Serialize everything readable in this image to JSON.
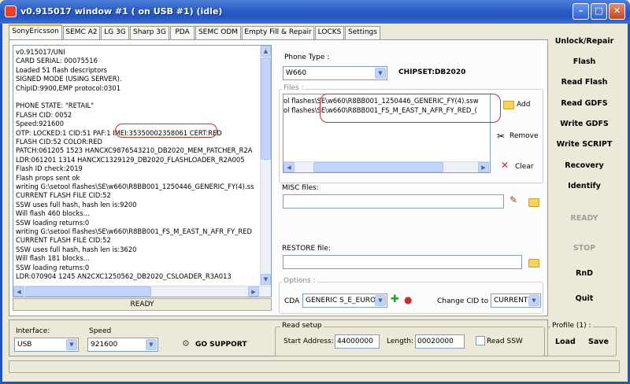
{
  "window": {
    "title": "v0.915017 window #1 ( on USB #1) (idle)",
    "minimize": "–",
    "maximize": "□",
    "close": "✕"
  },
  "tabs": [
    {
      "label": "SonyEricsson",
      "active": true
    },
    {
      "label": "SEMC A2"
    },
    {
      "label": "LG 3G"
    },
    {
      "label": "Sharp 3G"
    },
    {
      "label": "PDA"
    },
    {
      "label": "SEMC ODM"
    },
    {
      "label": "Empty Fill & Repair"
    },
    {
      "label": "LOCKS"
    },
    {
      "label": "Settings"
    }
  ],
  "log": {
    "lines": [
      "v0.915017/UNI",
      "CARD SERIAL: 00075516",
      "Loaded 51 flash descriptors",
      "SIGNED MODE (USING SERVER).",
      "ChipID:9900,EMP protocol:0301",
      "",
      "PHONE STATE: \"RETAIL\"",
      "FLASH CID: 0052",
      "Speed:921600",
      "OTP: LOCKED:1 CID:51 PAF:1 IMEI:35350002358061 CERT:RED",
      "FLASH CID:52 COLOR:RED",
      "PATCH:061205 1523 HANCXC9876543210_DB2020_MEM_PATCHER_R2A",
      "LDR:061201 1314 HANCXC1329129_DB2020_FLASHLOADER_R2A005",
      "Flash ID check:2019",
      "Flash props sent ok",
      "writing G:\\setool flashes\\SE\\w660\\R8BB001_1250446_GENERIC_FY(4).ss",
      "CURRENT FLASH FILE CID:52",
      "SSW uses full hash, hash len is:9200",
      "Will flash 460 blocks...",
      "SSW loading returns:0",
      "writing G:\\setool flashes\\SE\\w660\\R8BB001_FS_M_EAST_N_AFR_FY_RED",
      "CURRENT FLASH FILE CID:52",
      "SSW uses full hash, hash len is:3620",
      "Will flash 181 blocks...",
      "SSW loading returns:0",
      "LDR:070904 1245 AN2CXC1250562_DB2020_CSLOADER_R3A013"
    ],
    "status": "READY"
  },
  "phone": {
    "label": "Phone Type :",
    "value": "W660",
    "chipset": "CHIPSET:DB2020"
  },
  "files": {
    "label": "Files :",
    "rows": [
      "ol flashes\\SE\\w660\\R8BB001_1250446_GENERIC_FY(4).ssw",
      "ol flashes\\SE\\w660\\R8BB001_FS_M_EAST_N_AFR_FY_RED_("
    ],
    "add": "Add",
    "remove": "Remove",
    "clear": "Clear"
  },
  "misc": {
    "label": "MISC files:",
    "value": ""
  },
  "restore": {
    "label": "RESTORE file:",
    "value": ""
  },
  "options": {
    "label": "Options :",
    "cda_label": "CDA",
    "cda_value": "GENERIC S_E_EURO",
    "change_cid_label": "Change CID to",
    "change_cid_value": "CURRENT"
  },
  "right_buttons": [
    {
      "label": "Unlock/Repair",
      "enabled": true
    },
    {
      "label": "Flash",
      "enabled": true
    },
    {
      "label": "Read Flash",
      "enabled": true
    },
    {
      "label": "Read GDFS",
      "enabled": true
    },
    {
      "label": "Write GDFS",
      "enabled": true
    },
    {
      "label": "Write SCRIPT",
      "enabled": true
    },
    {
      "label": "Recovery",
      "enabled": true
    },
    {
      "label": "Identify",
      "enabled": true
    },
    {
      "label": "READY",
      "enabled": false
    },
    {
      "label": "STOP",
      "enabled": false
    },
    {
      "label": "RnD",
      "enabled": true
    },
    {
      "label": "Quit",
      "enabled": true
    }
  ],
  "interface": {
    "label": "Interface:",
    "value": "USB"
  },
  "speed": {
    "label": "Speed",
    "value": "921600"
  },
  "go_support": "GO SUPPORT",
  "read_setup": {
    "title": "Read setup",
    "start_label": "Start Address:",
    "start_value": "44000000",
    "length_label": "Length:",
    "length_value": "00020000",
    "read_ssw": "Read SSW",
    "read_ssw_checked": false
  },
  "profile": {
    "title": "Profile (1) :",
    "load": "Load",
    "save": "Save"
  },
  "icons": {
    "app": "app-icon",
    "go_support": "go-support-icon",
    "add": "folder-icon",
    "remove": "scissors-icon",
    "clear": "x-icon"
  },
  "colors": {
    "titlebar": "#2455c0",
    "highlight": "#c8302c",
    "tab_active": "#e6a23c"
  }
}
